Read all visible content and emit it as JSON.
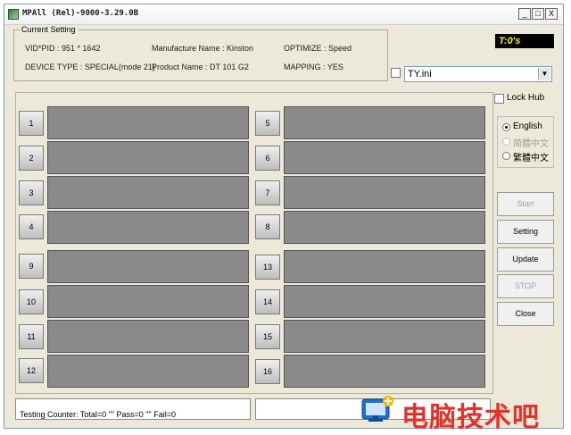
{
  "window": {
    "title": "MPAll (Rel)-9000-3.29.0B",
    "controls": {
      "minimize": "_",
      "maximize": "□",
      "close": "X"
    }
  },
  "settings": {
    "legend": "Current Setting",
    "vid_pid": "VID*PID :  951 * 1642",
    "manufacture": "Manufacture Name : Kinston",
    "optimize": "OPTIMIZE : Speed",
    "device_type": "DEVICE TYPE : SPECIAL(mode 21)",
    "product": "Product Name : DT 101 G2",
    "mapping": "MAPPING : YES"
  },
  "timer": "T:0's",
  "ini_select": {
    "value": "TY.ini"
  },
  "lock_hub": {
    "label": "Lock Hub"
  },
  "language": {
    "options": [
      {
        "label": "English",
        "selected": true,
        "disabled": false
      },
      {
        "label": "简體中文",
        "selected": false,
        "disabled": true
      },
      {
        "label": "繁體中文",
        "selected": false,
        "disabled": false
      }
    ]
  },
  "buttons": {
    "start": "Start",
    "setting": "Setting",
    "update": "Update",
    "stop": "STOP",
    "close": "Close"
  },
  "ports": [
    "1",
    "2",
    "3",
    "4",
    "5",
    "6",
    "7",
    "8",
    "9",
    "10",
    "11",
    "12",
    "13",
    "14",
    "15",
    "16"
  ],
  "status": {
    "counter": "Testing Counter: Total=0 \"\" Pass=0 \"\" Fail=0"
  },
  "watermark": {
    "text": "电脑技术吧"
  }
}
